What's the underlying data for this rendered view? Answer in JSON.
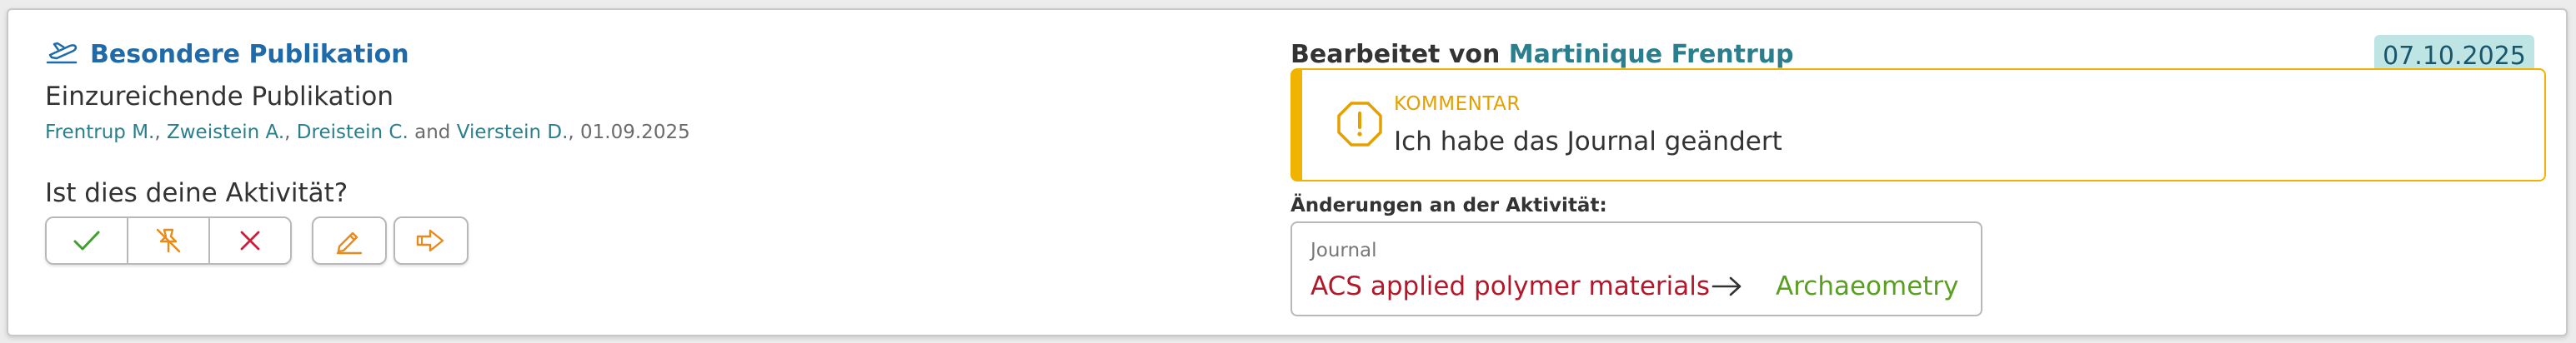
{
  "publication": {
    "type_label": "Besondere Publikation",
    "type_icon": "plane-icon",
    "subtitle": "Einzureichende Publikation",
    "authors": [
      "Frentrup M.",
      "Zweistein A.",
      "Dreistein C.",
      "Vierstein D."
    ],
    "sep1": ", ",
    "sep2": ", ",
    "and_word": " and ",
    "date_suffix": ", 01.09.2025"
  },
  "question": "Ist dies deine Aktivität?",
  "buttons": {
    "confirm_icon": "check-icon",
    "not_mine_icon": "pin-off-icon",
    "reject_icon": "x-icon",
    "edit_icon": "pencil-icon",
    "forward_icon": "arrow-right-icon"
  },
  "edited": {
    "prefix": "Bearbeitet von ",
    "user": "Martinique Frentrup",
    "date": "07.10.2025"
  },
  "comment": {
    "label": "KOMMENTAR",
    "text": "Ich habe das Journal geändert",
    "icon": "exclamation-octagon-icon"
  },
  "changes": {
    "title": "Änderungen an der Aktivität:",
    "field": "Journal",
    "old_value": "ACS applied polymer materials",
    "new_value": "Archaeometry"
  },
  "colors": {
    "accent_blue": "#1f6aa8",
    "teal": "#2a7f8e",
    "warning": "#f0b400",
    "old": "#b5172a",
    "new": "#5aa020",
    "confirm": "#3fa02c",
    "orange": "#e98a1a",
    "reject": "#c8203a"
  }
}
